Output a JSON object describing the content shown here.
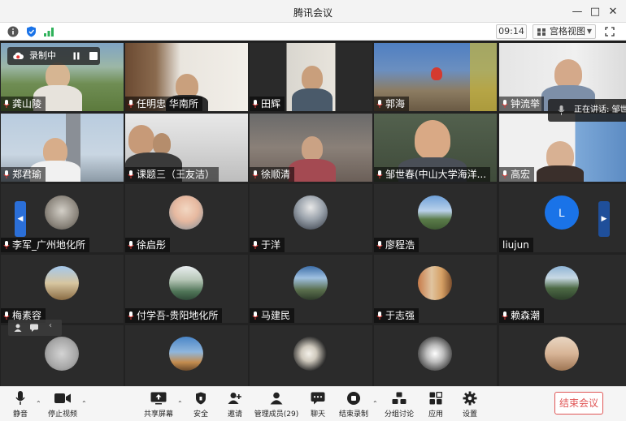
{
  "window": {
    "title": "腾讯会议"
  },
  "statusbar": {
    "time": "09:14",
    "view_label": "宫格视图"
  },
  "recording": {
    "label": "录制中"
  },
  "speaking": {
    "label": "正在讲话: 邹世"
  },
  "colors": {
    "accent": "#1a73e8",
    "end": "#e05656",
    "mic_red": "#e53935"
  },
  "tiles": [
    {
      "name": "龚山陵",
      "mic": true
    },
    {
      "name": "任明忠 华南所",
      "mic": true
    },
    {
      "name": "田辉",
      "mic": true
    },
    {
      "name": "郭海",
      "mic": true
    },
    {
      "name": "钟流举",
      "mic": true
    },
    {
      "name": "郑君瑜",
      "mic": true
    },
    {
      "name": "课题三（王友洁）",
      "mic": true
    },
    {
      "name": "徐顺清",
      "mic": true
    },
    {
      "name": "邹世春(中山大学海洋...",
      "mic": true
    },
    {
      "name": "高宏",
      "mic": true
    },
    {
      "name": "李军_广州地化所",
      "mic": true
    },
    {
      "name": "徐启彤",
      "mic": true
    },
    {
      "name": "于洋",
      "mic": true
    },
    {
      "name": "廖程浩",
      "mic": true
    },
    {
      "name": "liujun",
      "mic": false,
      "letter": "L"
    },
    {
      "name": "梅素容",
      "mic": true
    },
    {
      "name": "付学吾-贵阳地化所",
      "mic": true
    },
    {
      "name": "马建民",
      "mic": true
    },
    {
      "name": "于志强",
      "mic": true
    },
    {
      "name": "赖森潮",
      "mic": true
    }
  ],
  "toolbar": {
    "mute": "静音",
    "video": "停止视频",
    "share": "共享屏幕",
    "security": "安全",
    "invite": "邀请",
    "members": "管理成员(29)",
    "chat": "聊天",
    "record": "结束录制",
    "breakout": "分组讨论",
    "apps": "应用",
    "settings": "设置",
    "end": "结束会议"
  }
}
